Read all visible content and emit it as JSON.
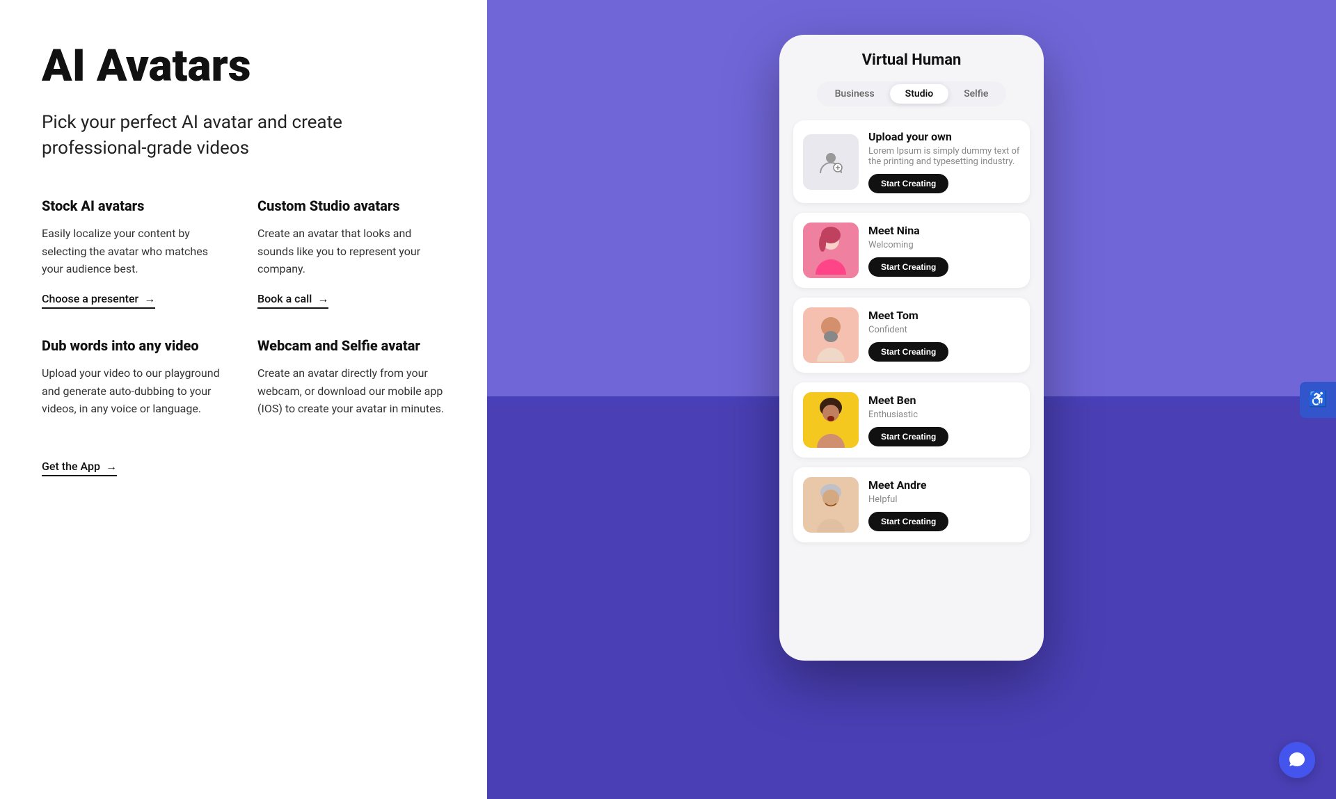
{
  "header": {
    "title": "AI Avatars",
    "subtitle": "Pick your perfect AI avatar and create professional-grade videos"
  },
  "features": [
    {
      "id": "stock-avatars",
      "title": "Stock AI avatars",
      "desc": "Easily localize your content by selecting the avatar who matches your audience best.",
      "link_text": "Choose a presenter",
      "link_arrow": "→"
    },
    {
      "id": "custom-studio",
      "title": "Custom Studio avatars",
      "desc": "Create an avatar that looks and sounds like you to represent your company.",
      "link_text": "Book a call",
      "link_arrow": "→"
    },
    {
      "id": "dub-words",
      "title": "Dub words into any video",
      "desc": "Upload your video to our playground and generate auto-dubbing to your videos, in any voice or language.",
      "link_text": "Get the App",
      "link_arrow": "→"
    },
    {
      "id": "webcam-selfie",
      "title": "Webcam and Selfie avatar",
      "desc": "Create an avatar directly from your webcam, or download our mobile app (IOS) to create your avatar in minutes.",
      "link_text": "Get the App",
      "link_arrow": "→"
    }
  ],
  "phone": {
    "title": "Virtual Human",
    "tabs": [
      "Business",
      "Studio",
      "Selfie"
    ],
    "active_tab": "Studio",
    "avatars": [
      {
        "id": "upload",
        "name": "Upload your own",
        "desc": "Lorem Ipsum is simply dummy text of the printing and typesetting industry.",
        "btn": "Start Creating",
        "type": "upload"
      },
      {
        "id": "nina",
        "name": "Meet Nina",
        "desc": "Welcoming",
        "btn": "Start Creating",
        "type": "nina"
      },
      {
        "id": "tom",
        "name": "Meet Tom",
        "desc": "Confident",
        "btn": "Start Creating",
        "type": "tom"
      },
      {
        "id": "ben",
        "name": "Meet Ben",
        "desc": "Enthusiastic",
        "btn": "Start Creating",
        "type": "ben"
      },
      {
        "id": "andre",
        "name": "Meet Andre",
        "desc": "Helpful",
        "btn": "Start Creating",
        "type": "andre"
      }
    ]
  },
  "accessibility": {
    "label": "Accessibility"
  },
  "chat": {
    "label": "Chat"
  }
}
